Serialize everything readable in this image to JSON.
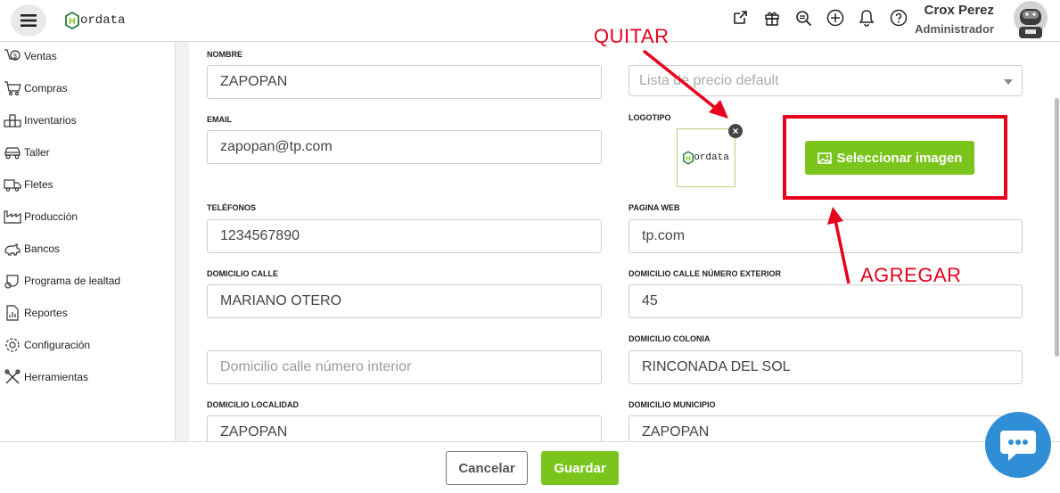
{
  "header": {
    "brand": "ordata",
    "user_name": "Crox Perez",
    "user_role": "Administrador",
    "icons": [
      "external-link-icon",
      "gift-icon",
      "search-zoom-icon",
      "add-circle-icon",
      "bell-icon",
      "help-icon"
    ]
  },
  "sidebar": {
    "items": [
      {
        "label": "Ventas",
        "icon": "sales-icon"
      },
      {
        "label": "Compras",
        "icon": "cart-icon"
      },
      {
        "label": "Inventarios",
        "icon": "inventory-icon"
      },
      {
        "label": "Taller",
        "icon": "car-icon"
      },
      {
        "label": "Fletes",
        "icon": "truck-icon"
      },
      {
        "label": "Producción",
        "icon": "factory-icon"
      },
      {
        "label": "Bancos",
        "icon": "bank-icon"
      },
      {
        "label": "Programa de lealtad",
        "icon": "loyalty-icon"
      },
      {
        "label": "Reportes",
        "icon": "report-icon"
      },
      {
        "label": "Configuración",
        "icon": "gear-icon"
      },
      {
        "label": "Herramientas",
        "icon": "tools-icon"
      }
    ]
  },
  "form": {
    "nombre": {
      "label": "NOMBRE",
      "value": "ZAPOPAN"
    },
    "lista_precio": {
      "placeholder": "Lista de precio default"
    },
    "email": {
      "label": "EMAIL",
      "value": "zapopan@tp.com"
    },
    "logotipo": {
      "label": "LOGOTIPO",
      "logo_text": "ordata",
      "select_button": "Seleccionar imagen"
    },
    "telefonos": {
      "label": "TELÉFONOS",
      "value": "1234567890"
    },
    "pagina_web": {
      "label": "PAGINA WEB",
      "value": "tp.com"
    },
    "domicilio_calle": {
      "label": "DOMICILIO CALLE",
      "value": "MARIANO OTERO"
    },
    "numero_exterior": {
      "label": "DOMICILIO CALLE NÚMERO EXTERIOR",
      "value": "45"
    },
    "numero_interior": {
      "placeholder": "Domicilio calle número interior"
    },
    "colonia": {
      "label": "DOMICILIO COLONIA",
      "value": "RINCONADA DEL SOL"
    },
    "localidad": {
      "label": "DOMICILIO LOCALIDAD",
      "value": "ZAPOPAN"
    },
    "municipio": {
      "label": "DOMICILIO MUNICIPIO",
      "value": "ZAPOPAN"
    }
  },
  "annotations": {
    "quitar": "QUITAR",
    "agregar": "AGREGAR",
    "color": "#e8001c"
  },
  "footer": {
    "cancel": "Cancelar",
    "save": "Guardar"
  },
  "colors": {
    "accent_green": "#7ac41b",
    "chat_blue": "#2f8ed6"
  }
}
